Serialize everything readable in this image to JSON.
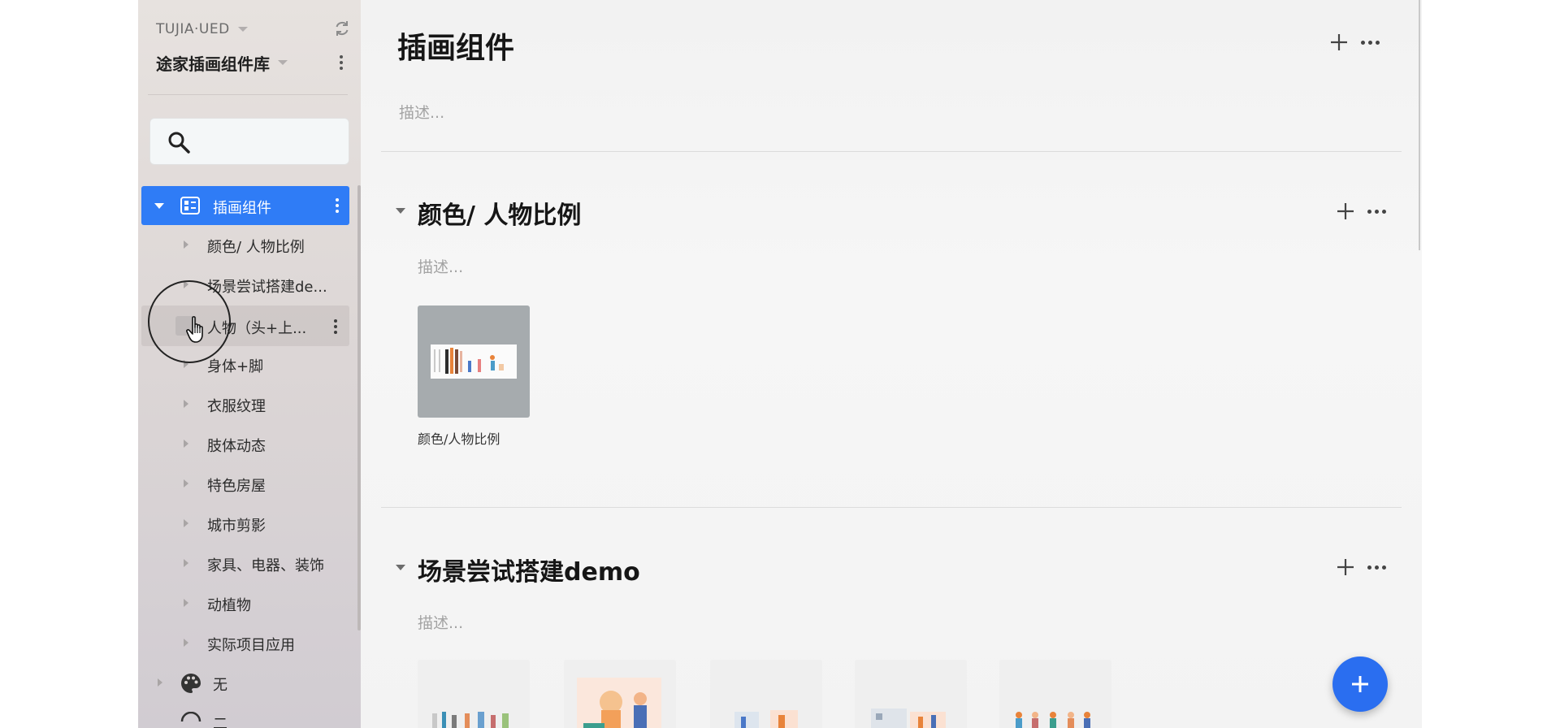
{
  "sidebar": {
    "team_name": "TUJIA·UED",
    "project_name": "途家插画组件库",
    "search": {
      "placeholder": "",
      "value": ""
    },
    "root_item": {
      "label": "插画组件"
    },
    "items": [
      {
        "label": "颜色/ 人物比例"
      },
      {
        "label": "场景尝试搭建de..."
      },
      {
        "label": "人物（头+上..."
      },
      {
        "label": "身体+脚"
      },
      {
        "label": "衣服纹理"
      },
      {
        "label": "肢体动态"
      },
      {
        "label": "特色房屋"
      },
      {
        "label": "城市剪影"
      },
      {
        "label": "家具、电器、装饰"
      },
      {
        "label": "动植物"
      },
      {
        "label": "实际项目应用"
      }
    ],
    "top_items": [
      {
        "label": "无",
        "icon": "palette-icon"
      },
      {
        "label": "二",
        "icon": "circle-icon"
      }
    ]
  },
  "main": {
    "page_title": "插画组件",
    "page_desc": "描述...",
    "sections": [
      {
        "title": "颜色/ 人物比例",
        "desc": "描述...",
        "cards": [
          {
            "label": "颜色/人物比例"
          }
        ]
      },
      {
        "title": "场景尝试搭建demo",
        "desc": "描述..."
      }
    ]
  },
  "colors": {
    "accent": "#2f7cf6",
    "fab": "#2a6ef0",
    "muted_text": "#a3a3a3"
  }
}
